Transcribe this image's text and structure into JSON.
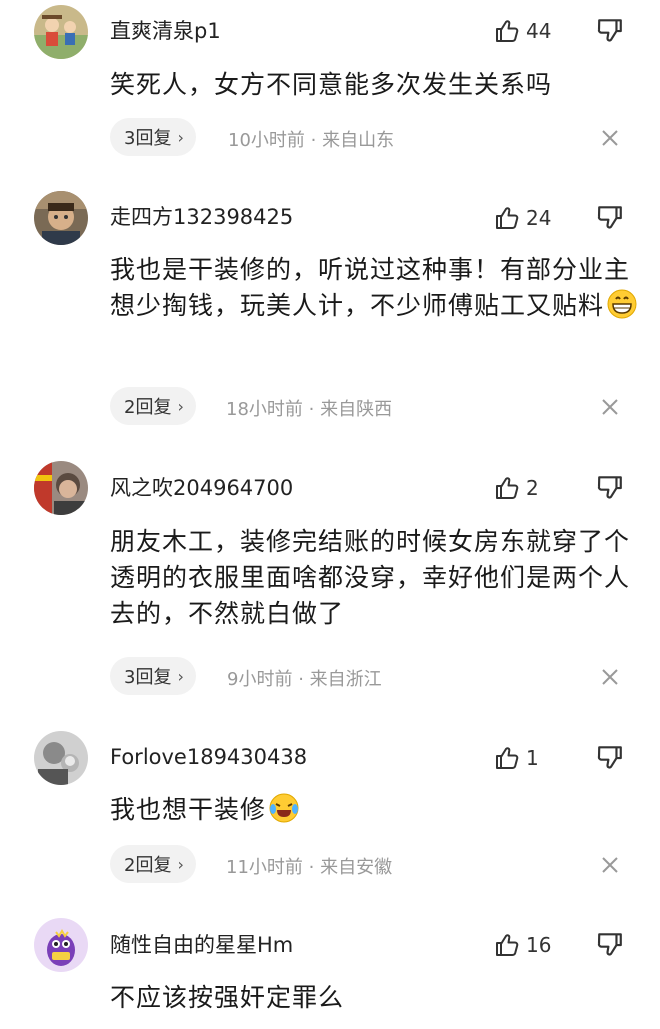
{
  "comments": [
    {
      "username": "直爽清泉p1",
      "likes": "44",
      "text": "笑死人，女方不同意能多次发生关系吗",
      "replies": "3回复",
      "time": "10小时前",
      "separator": "·",
      "location": "来自山东",
      "avatar_icon": "avatar-cartoon-kids",
      "emoji": ""
    },
    {
      "username": "走四方132398425",
      "likes": "24",
      "text": "我也是干装修的，听说过这种事！有部分业主想少掏钱，玩美人计，不少师傅贴工又贴料",
      "replies": "2回复",
      "time": "18小时前",
      "separator": "·",
      "location": "来自陕西",
      "avatar_icon": "avatar-man-photo",
      "emoji": "grinning-emoji"
    },
    {
      "username": "风之吹204964700",
      "likes": "2",
      "text": "朋友木工，装修完结账的时候女房东就穿了个透明的衣服里面啥都没穿，幸好他们是两个人去的，不然就白做了",
      "replies": "3回复",
      "time": "9小时前",
      "separator": "·",
      "location": "来自浙江",
      "avatar_icon": "avatar-person-photo",
      "emoji": ""
    },
    {
      "username": "Forlove189430438",
      "likes": "1",
      "text": "我也想干装修",
      "replies": "2回复",
      "time": "11小时前",
      "separator": "·",
      "location": "来自安徽",
      "avatar_icon": "avatar-grayscale-photo",
      "emoji": "crying-laughing-emoji"
    },
    {
      "username": "随性自由的星星Hm",
      "likes": "16",
      "text": "不应该按强奸定罪么",
      "avatar_icon": "avatar-purple-cartoon",
      "emoji": ""
    }
  ],
  "colors": {
    "text": "#1a1a1a",
    "meta": "#999999",
    "pill_bg": "#f2f2f2",
    "icon": "#333333"
  }
}
